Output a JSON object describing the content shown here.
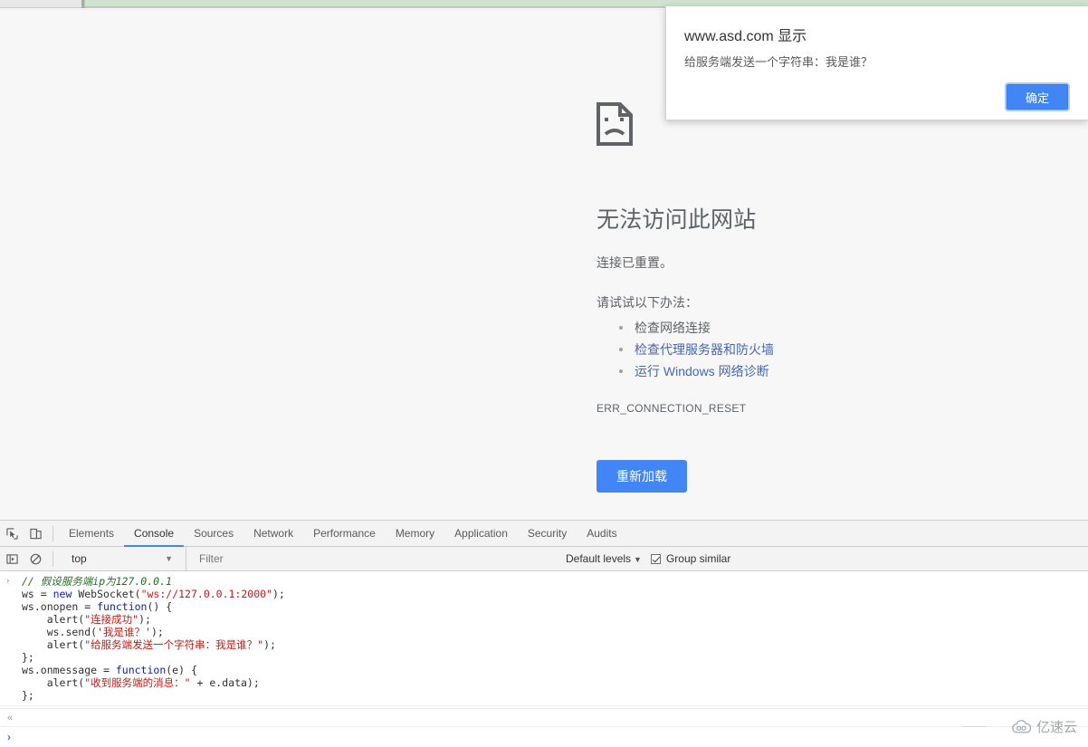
{
  "dialog": {
    "origin": "www.asd.com 显示",
    "message": "给服务端发送一个字符串：我是谁？",
    "ok_label": "确定",
    "accent": "#4285f4"
  },
  "error_page": {
    "icon": "sad-page-icon",
    "title": "无法访问此网站",
    "subtitle": "连接已重置。",
    "try_label": "请试试以下办法：",
    "suggestions": [
      {
        "text": "检查网络连接",
        "is_link": false
      },
      {
        "text": "检查代理服务器和防火墙",
        "is_link": true
      },
      {
        "text": "运行 Windows 网络诊断",
        "is_link": true
      }
    ],
    "error_code": "ERR_CONNECTION_RESET",
    "reload_label": "重新加载",
    "link_color": "#4667b5",
    "button_color": "#4285f4"
  },
  "devtools": {
    "toolbar_icons": [
      {
        "name": "inspect-element-icon"
      },
      {
        "name": "device-toolbar-icon"
      }
    ],
    "tabs": [
      {
        "label": "Elements",
        "active": false
      },
      {
        "label": "Console",
        "active": true
      },
      {
        "label": "Sources",
        "active": false
      },
      {
        "label": "Network",
        "active": false
      },
      {
        "label": "Performance",
        "active": false
      },
      {
        "label": "Memory",
        "active": false
      },
      {
        "label": "Application",
        "active": false
      },
      {
        "label": "Security",
        "active": false
      },
      {
        "label": "Audits",
        "active": false
      }
    ],
    "filter_bar": {
      "sidebar_toggle_icon": "console-sidebar-icon",
      "clear_icon": "clear-console-icon",
      "context": "top",
      "filter_placeholder": "Filter",
      "filter_value": "",
      "levels_label": "Default levels",
      "group_similar_label": "Group similar",
      "group_similar_checked": true
    },
    "console": {
      "entry_arrow": "›",
      "code_lines": [
        [
          {
            "t": "// 假设服务端ip为127.0.0.1",
            "c": "c-comment"
          }
        ],
        [
          {
            "t": "ws = ",
            "c": "c-plain"
          },
          {
            "t": "new",
            "c": "c-kw"
          },
          {
            "t": " WebSocket(",
            "c": "c-plain"
          },
          {
            "t": "\"ws://127.0.0.1:2000\"",
            "c": "c-str"
          },
          {
            "t": ");",
            "c": "c-plain"
          }
        ],
        [
          {
            "t": "ws.onopen = ",
            "c": "c-plain"
          },
          {
            "t": "function",
            "c": "c-kw"
          },
          {
            "t": "() {",
            "c": "c-plain"
          }
        ],
        [
          {
            "t": "    alert(",
            "c": "c-plain"
          },
          {
            "t": "\"连接成功\"",
            "c": "c-str"
          },
          {
            "t": ");",
            "c": "c-plain"
          }
        ],
        [
          {
            "t": "    ws.send(",
            "c": "c-plain"
          },
          {
            "t": "'我是谁？'",
            "c": "c-str"
          },
          {
            "t": ");",
            "c": "c-plain"
          }
        ],
        [
          {
            "t": "    alert(",
            "c": "c-plain"
          },
          {
            "t": "\"给服务端发送一个字符串：我是谁？\"",
            "c": "c-str"
          },
          {
            "t": ");",
            "c": "c-plain"
          }
        ],
        [
          {
            "t": "};",
            "c": "c-plain"
          }
        ],
        [
          {
            "t": "ws.onmessage = ",
            "c": "c-plain"
          },
          {
            "t": "function",
            "c": "c-kw"
          },
          {
            "t": "(e) {",
            "c": "c-plain"
          }
        ],
        [
          {
            "t": "    alert(",
            "c": "c-plain"
          },
          {
            "t": "\"收到服务端的消息：\"",
            "c": "c-str"
          },
          {
            "t": " + e.data);",
            "c": "c-plain"
          }
        ],
        [
          {
            "t": "};",
            "c": "c-plain"
          }
        ]
      ],
      "collapse_glyph": "«",
      "prompt_caret": "›",
      "prompt_value": ""
    }
  },
  "watermark": {
    "text": "亿速云",
    "icon": "cloud-icon"
  }
}
